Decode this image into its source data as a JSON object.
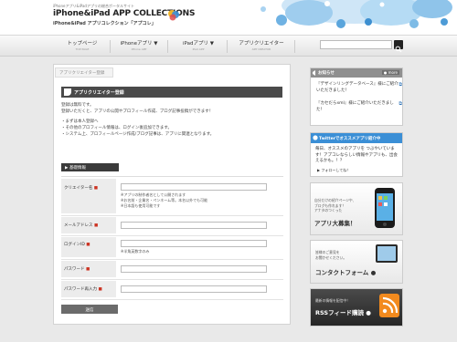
{
  "header": {
    "tagline": "iPhoneアプリ&iPadアプリの総合ポータルサイト",
    "title": "iPhone&iPad APP COLLECTIONS",
    "subtitle": "iPhone&iPad アプリコレクション「アプコレ」"
  },
  "nav": {
    "items": [
      {
        "label": "トップページ",
        "sub": "TOP PAGE"
      },
      {
        "label": "iPhoneアプリ ▼",
        "sub": "iPhone APP"
      },
      {
        "label": "iPadアプリ ▼",
        "sub": "iPad APP"
      },
      {
        "label": "アプリクリエイター",
        "sub": "APP CREATOR"
      }
    ]
  },
  "main": {
    "tab": "アプリクリエイター登録",
    "title": "アプリクリエイター登録",
    "intro_lines": [
      "登録は無料です。",
      "登録いただくと、アプリの公開やプロフィール作成、ブログ記事投稿ができます！",
      "",
      "・まずは本人登録へ",
      "・その他のプロフィール情報は、ログイン後追加できます。",
      "・システム上、プロフィールページ作成/ブログ記事は、アプリに関連となります。"
    ],
    "section_label": "▶ 基礎情報",
    "fields": [
      {
        "label": "クリエイター名",
        "notes": [
          "※アプリの制作者名として公開されます",
          "※お名前・企業名・ペンネーム等。本名以外でも可能",
          "※日本語も使用可能です"
        ]
      },
      {
        "label": "メールアドレス",
        "notes": []
      },
      {
        "label": "ログインID",
        "notes": [
          "※半角英数字のみ"
        ]
      },
      {
        "label": "パスワード",
        "notes": []
      },
      {
        "label": "パスワード再入力",
        "notes": []
      }
    ],
    "required_mark": "■",
    "submit": "送信"
  },
  "sidebar": {
    "news": {
      "title": "お知らせ",
      "more": "● more",
      "items": [
        "『デザインリングデータベース』様にご紹介いただきました！",
        "『カセだらxml』様にご紹介いただきました！"
      ]
    },
    "twitter": {
      "title": "Twitterでオススメアプリ紹介中",
      "body": "毎日、オススメのアプリを つぶやいています！アプコレならしい情報やアプリも、出会えるかも。！？",
      "follow": "▶ フォローしてね！"
    },
    "banner1": {
      "small": [
        "自分だけの紹介ページや、",
        "ブログも作れます！",
        "アナタのつくった"
      ],
      "big": "アプリ大募集！"
    },
    "banner2": {
      "small": [
        "皆様のご意見を",
        "お聞かせください。"
      ],
      "big": "コンタクトフォーム ●"
    },
    "banner3": {
      "small": [
        "最新の情報を配信中！"
      ],
      "big": "RSSフィード購読 ●"
    }
  },
  "colors": {
    "accent_blue": "#3b8fd6",
    "dark_bar": "#4a4a4a",
    "required_red": "#cc3322",
    "rss_orange": "#f28a1e"
  }
}
